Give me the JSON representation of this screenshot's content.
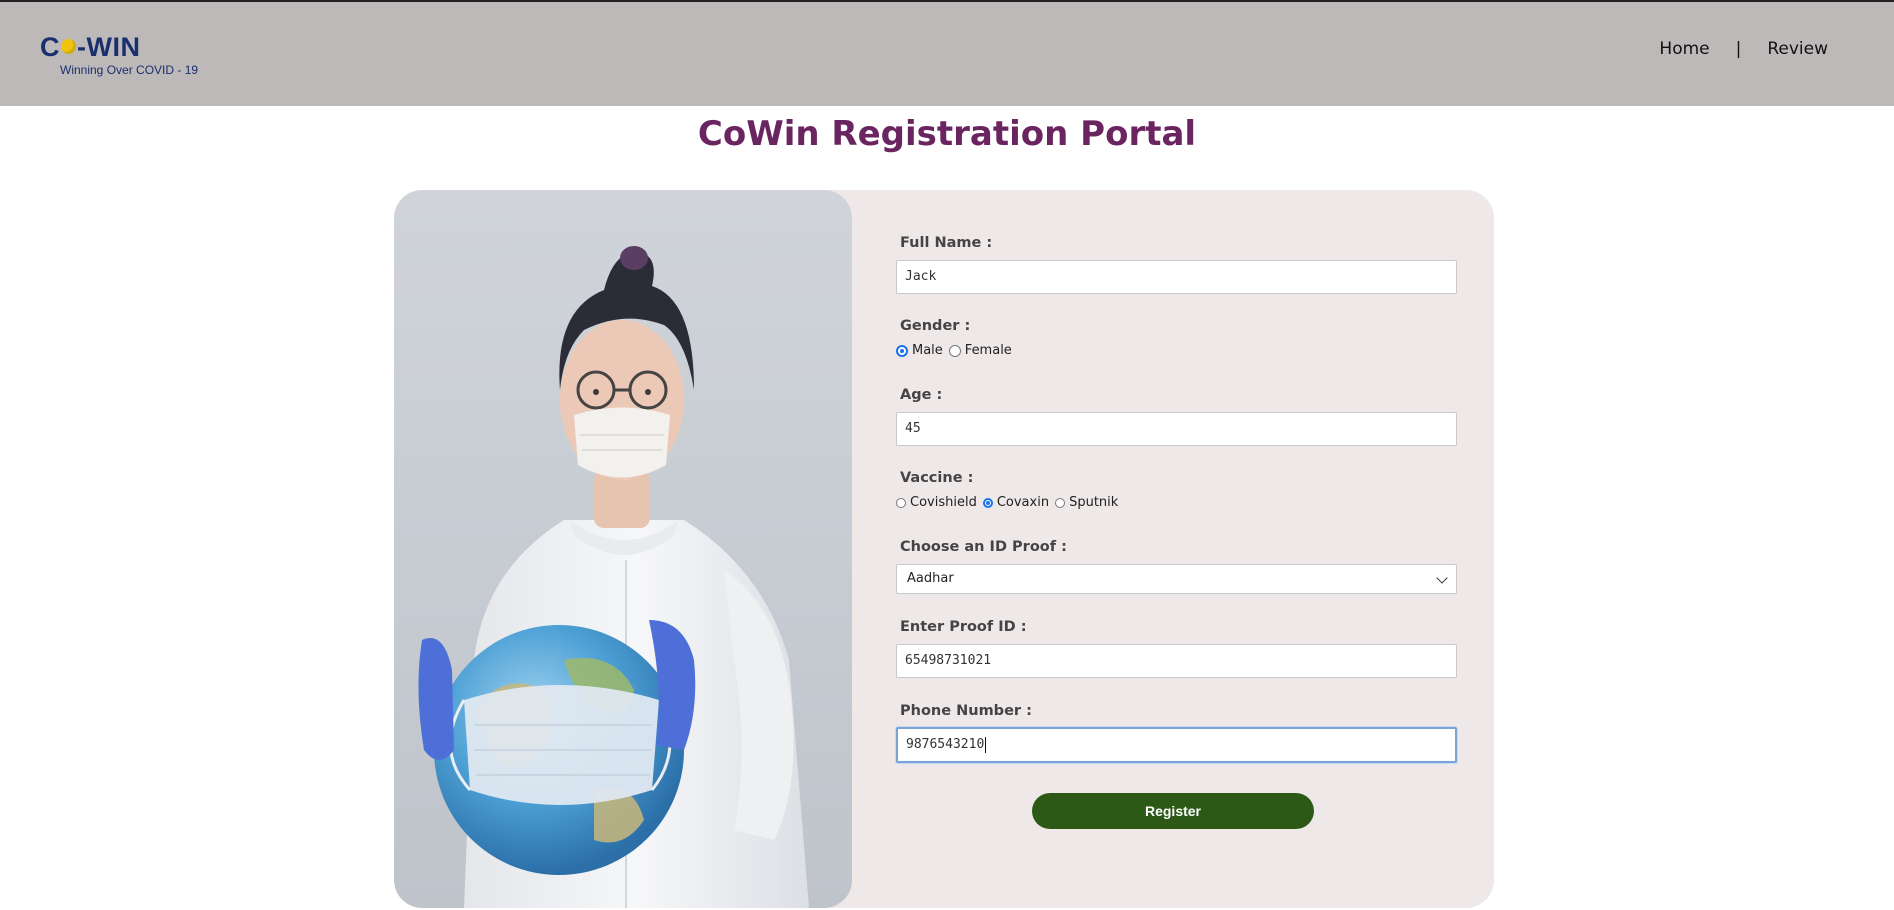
{
  "header": {
    "logo_main_prefix": "C",
    "logo_main_suffix": "-WIN",
    "logo_tagline": "Winning Over COVID - 19",
    "nav": {
      "home": "Home",
      "separator": "|",
      "review": "Review"
    }
  },
  "page_title": "CoWin Registration Portal",
  "form": {
    "full_name": {
      "label": "Full Name :",
      "value": "Jack"
    },
    "gender": {
      "label": "Gender :",
      "options": [
        "Male",
        "Female"
      ],
      "selected": "Male"
    },
    "age": {
      "label": "Age :",
      "value": "45"
    },
    "vaccine": {
      "label": "Vaccine :",
      "options": [
        "Covishield",
        "Covaxin",
        "Sputnik"
      ],
      "selected": "Covaxin"
    },
    "id_proof": {
      "label": "Choose an ID Proof :",
      "selected": "Aadhar"
    },
    "proof_id": {
      "label": "Enter Proof ID :",
      "value": "65498731021"
    },
    "phone": {
      "label": "Phone Number :",
      "value": "9876543210"
    },
    "register_label": "Register"
  },
  "colors": {
    "header_bg": "#bdb9b9",
    "title": "#6a2561",
    "card_bg": "#eee8e8",
    "register_bg": "#2c5a16",
    "logo": "#1a2f6e",
    "logo_dot": "#f1c40f"
  }
}
